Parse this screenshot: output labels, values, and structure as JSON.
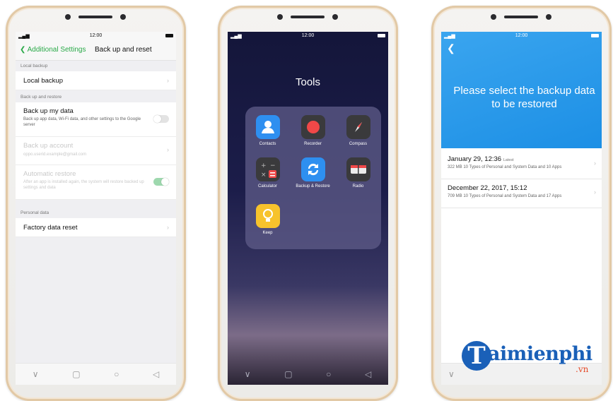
{
  "phone1": {
    "status": {
      "signal": "•••",
      "time": "12:00"
    },
    "header": {
      "back_label": "Additional Settings",
      "title": "Back up and reset"
    },
    "sections": {
      "local_backup": "Local backup",
      "backup_restore": "Back up and restore",
      "personal_data": "Personal data"
    },
    "rows": {
      "local_backup": {
        "label": "Local backup"
      },
      "backup_my_data": {
        "label": "Back up my data",
        "subtitle": "Back up app data, Wi-Fi data, and other settings to the Google server",
        "toggle_on": false
      },
      "backup_account": {
        "label": "Back up account",
        "subtitle": "oppo.userid.example@gmail.com"
      },
      "automatic_restore": {
        "label": "Automatic restore",
        "subtitle": "After an app is installed again, the system will restore backed up settings and data",
        "toggle_on": true
      },
      "factory_reset": {
        "label": "Factory data reset"
      }
    },
    "nav": {
      "menu": "∨",
      "home": "○",
      "back": "◁"
    }
  },
  "phone2": {
    "status": {
      "time": "12:00"
    },
    "folder_title": "Tools",
    "apps": {
      "contacts": "Contacts",
      "recorder": "Recorder",
      "compass": "Compass",
      "calculator": "Calculator",
      "backup_restore": "Backup & Restore",
      "radio": "Radio",
      "keep": "Keep"
    },
    "nav": {
      "menu": "∨",
      "home": "○",
      "back": "◁"
    }
  },
  "phone3": {
    "status": {
      "time": "12:00"
    },
    "prompt": "Please select the backup data to be restored",
    "backups": [
      {
        "date": "January 29, 12:36",
        "badge": "Latest",
        "desc": "322 MB 10 Types of Personal and System Data and 10 Apps"
      },
      {
        "date": "December 22, 2017, 15:12",
        "badge": "",
        "desc": "709 MB 10 Types of Personal and System Data and 17 Apps"
      }
    ],
    "nav": {
      "menu": "∨"
    }
  },
  "watermark": {
    "letter": "T",
    "name": "aimienphi",
    "tld": ".vn"
  },
  "colors": {
    "accent_green": "#29a948",
    "blue": "#1c8fe5",
    "watermark_blue": "#1a60b8"
  }
}
